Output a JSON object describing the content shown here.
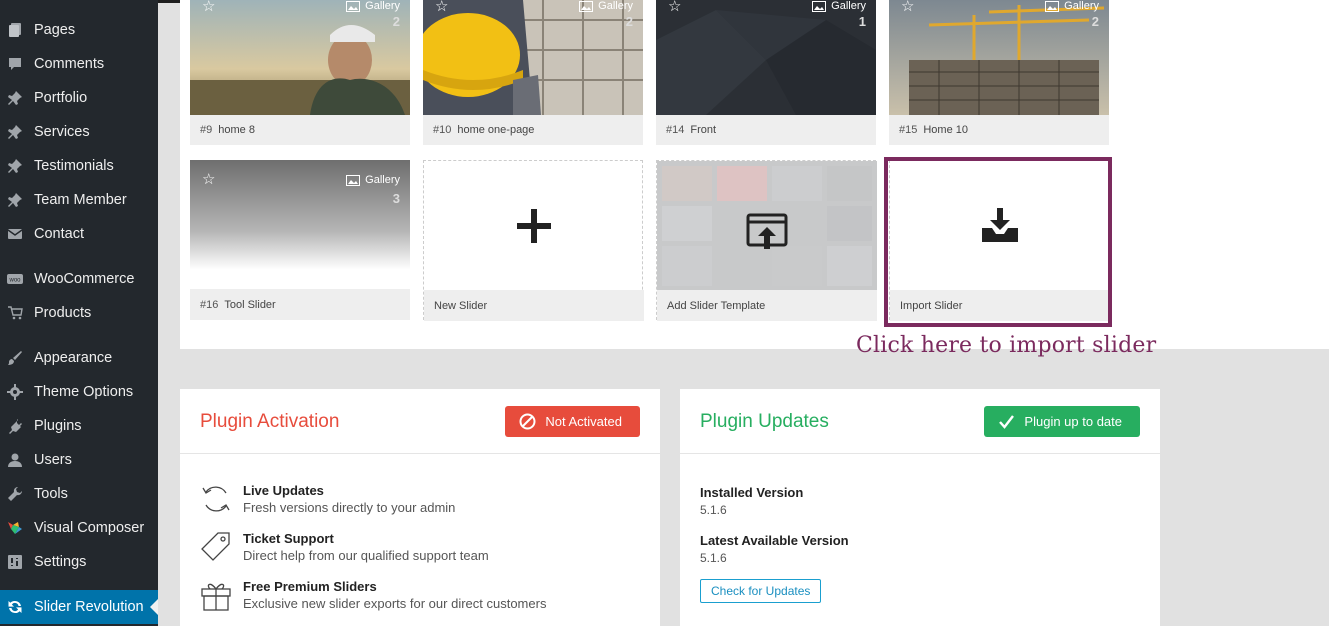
{
  "sidebar": {
    "items": [
      {
        "label": "Pages",
        "icon": "pages-icon"
      },
      {
        "label": "Comments",
        "icon": "comments-icon"
      },
      {
        "label": "Portfolio",
        "icon": "pin-icon"
      },
      {
        "label": "Services",
        "icon": "pin-icon"
      },
      {
        "label": "Testimonials",
        "icon": "pin-icon"
      },
      {
        "label": "Team Member",
        "icon": "pin-icon"
      },
      {
        "label": "Contact",
        "icon": "mail-icon"
      },
      {
        "label": "WooCommerce",
        "icon": "woo-icon"
      },
      {
        "label": "Products",
        "icon": "cart-icon"
      },
      {
        "label": "Appearance",
        "icon": "brush-icon"
      },
      {
        "label": "Theme Options",
        "icon": "gear-icon"
      },
      {
        "label": "Plugins",
        "icon": "plug-icon"
      },
      {
        "label": "Users",
        "icon": "user-icon"
      },
      {
        "label": "Tools",
        "icon": "wrench-icon"
      },
      {
        "label": "Visual Composer",
        "icon": "vc-icon"
      },
      {
        "label": "Settings",
        "icon": "settings-icon"
      },
      {
        "label": "Slider Revolution",
        "icon": "refresh-icon"
      }
    ]
  },
  "sliders": {
    "gallery_label": "Gallery",
    "row1": [
      {
        "num": "#9",
        "name": "home 8",
        "count": "2"
      },
      {
        "num": "#10",
        "name": "home one-page",
        "count": "2"
      },
      {
        "num": "#14",
        "name": "Front",
        "count": "1"
      },
      {
        "num": "#15",
        "name": "Home 10",
        "count": "2"
      }
    ],
    "row2": {
      "tool": {
        "num": "#16",
        "name": "Tool Slider",
        "count": "3"
      },
      "new_slider": "New Slider",
      "add_template": "Add Slider Template",
      "import_slider": "Import Slider"
    }
  },
  "annotation": "Click here to import slider",
  "activation": {
    "title": "Plugin Activation",
    "button": "Not Activated",
    "features": [
      {
        "title": "Live Updates",
        "desc": "Fresh versions directly to your admin"
      },
      {
        "title": "Ticket Support",
        "desc": "Direct help from our qualified support team"
      },
      {
        "title": "Free Premium Sliders",
        "desc": "Exclusive new slider exports for our direct customers"
      }
    ]
  },
  "updates": {
    "title": "Plugin Updates",
    "button": "Plugin up to date",
    "installed_label": "Installed Version",
    "installed_value": "5.1.6",
    "latest_label": "Latest Available Version",
    "latest_value": "5.1.6",
    "check_button": "Check for Updates"
  },
  "colors": {
    "sidebar_bg": "#23282d",
    "active_bg": "#0073aa",
    "activation_red": "#e74c3c",
    "updates_green": "#27ae60",
    "annotation": "#7b2a5e"
  }
}
